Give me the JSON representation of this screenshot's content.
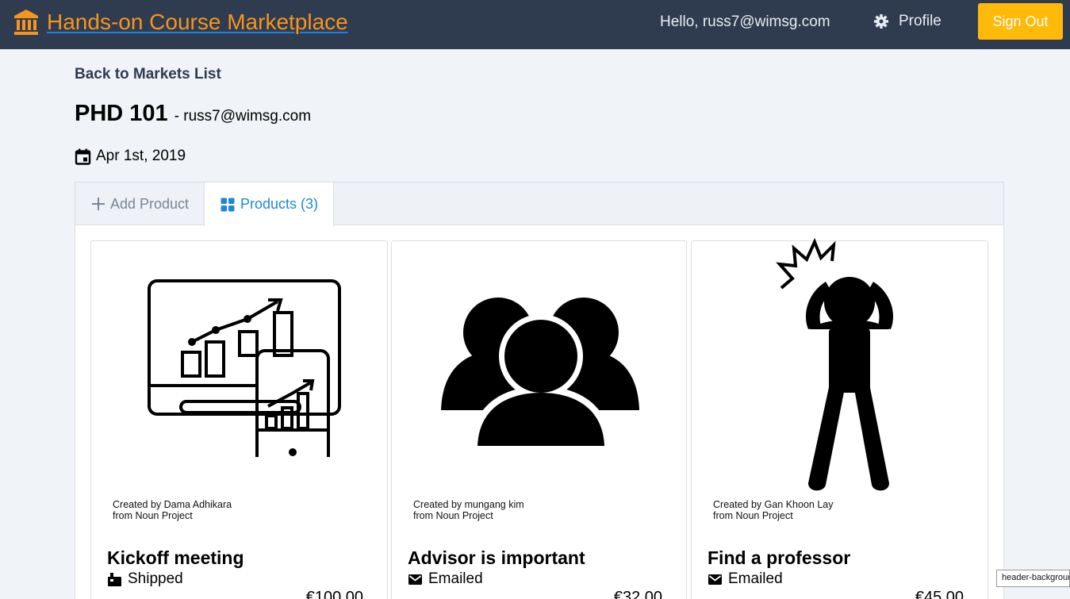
{
  "header": {
    "app_title": "Hands-on Course Marketplace",
    "greeting": "Hello, russ7@wimsg.com",
    "profile_label": "Profile",
    "signout_label": "Sign Out",
    "colors": {
      "background": "#2f3c50",
      "accent": "#f7941d",
      "signout": "#ffb908"
    }
  },
  "market": {
    "back_link": "Back to Markets List",
    "name": "PHD 101",
    "owner": "- russ7@wimsg.com",
    "date": "Apr 1st, 2019"
  },
  "tabs": {
    "add_product": "Add Product",
    "products": "Products (3)"
  },
  "products": [
    {
      "image_icon": "monitor-phone-chart-icon",
      "credit_line1": "Created by Dama Adhikara",
      "credit_line2": "from Noun Project",
      "title": "Kickoff meeting",
      "shipping": "Shipped",
      "shipping_icon": "package-icon",
      "price": "€100.00"
    },
    {
      "image_icon": "people-group-icon",
      "credit_line1": "Created by mungang kim",
      "credit_line2": "from Noun Project",
      "title": "Advisor is important",
      "shipping": "Emailed",
      "shipping_icon": "mail-icon",
      "price": "€32.00"
    },
    {
      "image_icon": "stressed-person-icon",
      "credit_line1": "Created by Gan Khoon Lay",
      "credit_line2": "from Noun Project",
      "title": "Find a professor",
      "shipping": "Emailed",
      "shipping_icon": "mail-icon",
      "price": "€45.00"
    }
  ],
  "tooltip": "header-background"
}
